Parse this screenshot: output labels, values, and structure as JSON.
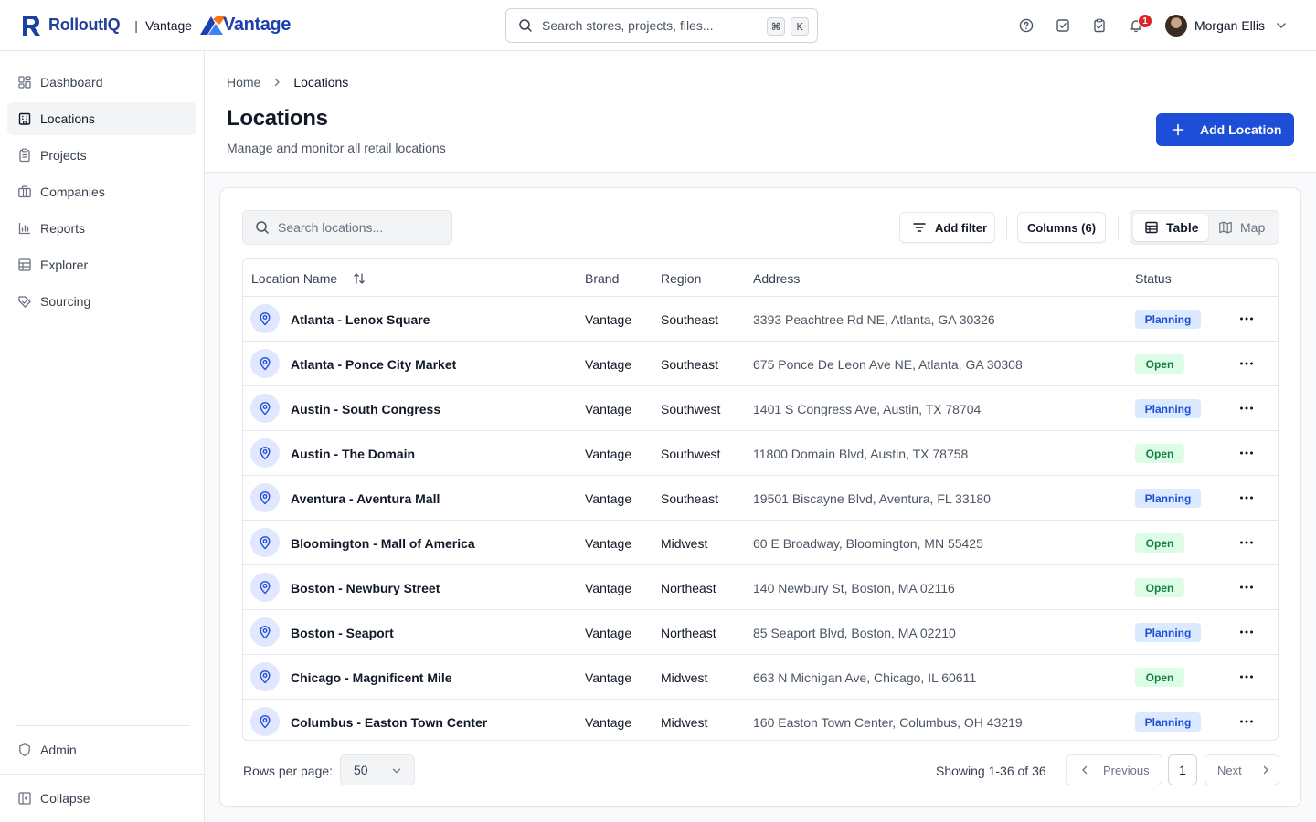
{
  "app": {
    "brand_name": "RolloutIQ",
    "separator": "|",
    "tenant": "Vantage",
    "tenant_logo_text": "Vantage",
    "accent_color": "#1d4ed8"
  },
  "search": {
    "placeholder": "Search stores, projects, files...",
    "shortcut_keys": [
      "⌘",
      "K"
    ]
  },
  "header_icons": [
    "help-icon",
    "check-square-icon",
    "clipboard-check-icon",
    "bell-icon"
  ],
  "notifications": {
    "count": "1"
  },
  "user": {
    "name": "Morgan Ellis"
  },
  "sidebar": {
    "items": [
      {
        "label": "Dashboard",
        "icon": "dashboard-icon"
      },
      {
        "label": "Locations",
        "icon": "building-icon",
        "active": true
      },
      {
        "label": "Projects",
        "icon": "clipboard-icon"
      },
      {
        "label": "Companies",
        "icon": "briefcase-icon"
      },
      {
        "label": "Reports",
        "icon": "bar-chart-icon"
      },
      {
        "label": "Explorer",
        "icon": "table-icon"
      },
      {
        "label": "Sourcing",
        "icon": "tag-icon"
      }
    ],
    "admin_label": "Admin",
    "collapse_label": "Collapse"
  },
  "breadcrumb": {
    "home": "Home",
    "current": "Locations"
  },
  "page": {
    "title": "Locations",
    "subtitle": "Manage and monitor all retail locations",
    "add_button": "Add Location"
  },
  "toolbar": {
    "search_placeholder": "Search locations...",
    "add_filter": "Add filter",
    "columns": "Columns (6)",
    "view_table": "Table",
    "view_map": "Map",
    "active_view": "Table"
  },
  "table": {
    "columns": [
      "Location Name",
      "Brand",
      "Region",
      "Address",
      "Status"
    ],
    "rows": [
      {
        "name": "Atlanta - Lenox Square",
        "brand": "Vantage",
        "region": "Southeast",
        "address": "3393 Peachtree Rd NE, Atlanta, GA 30326",
        "status": "Planning"
      },
      {
        "name": "Atlanta - Ponce City Market",
        "brand": "Vantage",
        "region": "Southeast",
        "address": "675 Ponce De Leon Ave NE, Atlanta, GA 30308",
        "status": "Open"
      },
      {
        "name": "Austin - South Congress",
        "brand": "Vantage",
        "region": "Southwest",
        "address": "1401 S Congress Ave, Austin, TX 78704",
        "status": "Planning"
      },
      {
        "name": "Austin - The Domain",
        "brand": "Vantage",
        "region": "Southwest",
        "address": "11800 Domain Blvd, Austin, TX 78758",
        "status": "Open"
      },
      {
        "name": "Aventura - Aventura Mall",
        "brand": "Vantage",
        "region": "Southeast",
        "address": "19501 Biscayne Blvd, Aventura, FL 33180",
        "status": "Planning"
      },
      {
        "name": "Bloomington - Mall of America",
        "brand": "Vantage",
        "region": "Midwest",
        "address": "60 E Broadway, Bloomington, MN 55425",
        "status": "Open"
      },
      {
        "name": "Boston - Newbury Street",
        "brand": "Vantage",
        "region": "Northeast",
        "address": "140 Newbury St, Boston, MA 02116",
        "status": "Open"
      },
      {
        "name": "Boston - Seaport",
        "brand": "Vantage",
        "region": "Northeast",
        "address": "85 Seaport Blvd, Boston, MA 02210",
        "status": "Planning"
      },
      {
        "name": "Chicago - Magnificent Mile",
        "brand": "Vantage",
        "region": "Midwest",
        "address": "663 N Michigan Ave, Chicago, IL 60611",
        "status": "Open"
      },
      {
        "name": "Columbus - Easton Town Center",
        "brand": "Vantage",
        "region": "Midwest",
        "address": "160 Easton Town Center, Columbus, OH 43219",
        "status": "Planning"
      }
    ]
  },
  "status_colors": {
    "Planning": {
      "bg": "#dbeafe",
      "fg": "#1d4ed8"
    },
    "Open": {
      "bg": "#dcfce7",
      "fg": "#15803d"
    }
  },
  "pagination": {
    "rows_per_page_label": "Rows per page:",
    "rows_per_page": "50",
    "showing": "Showing 1-36 of 36",
    "previous": "Previous",
    "current_page": "1",
    "next": "Next"
  }
}
